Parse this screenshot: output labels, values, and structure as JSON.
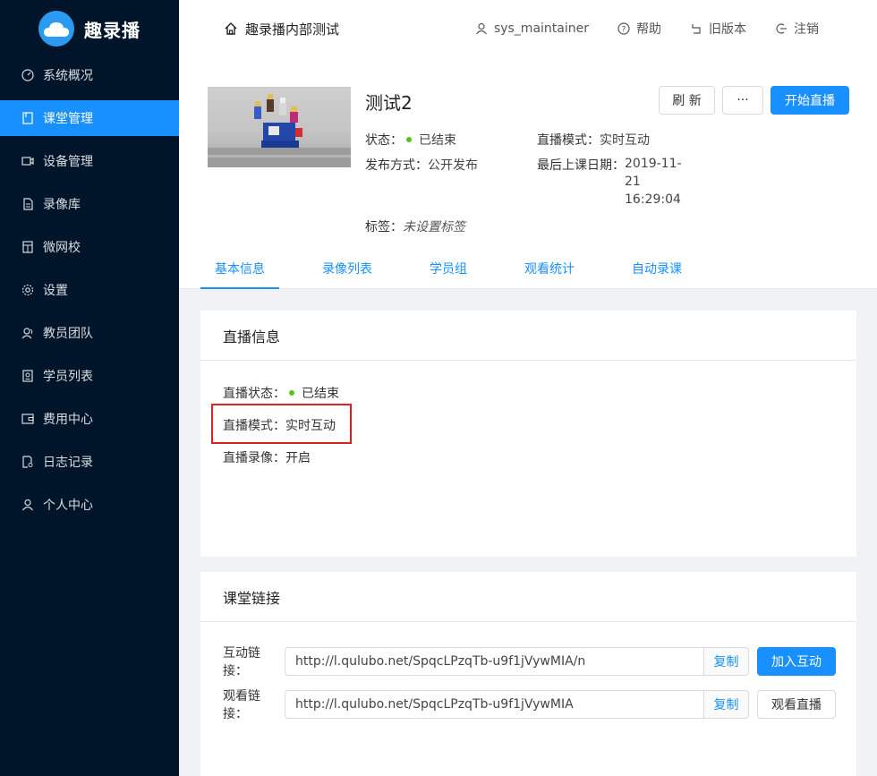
{
  "app": {
    "logo_text": "趣录播"
  },
  "sidebar": {
    "items": [
      {
        "label": "系统概况",
        "icon": "dashboard-icon"
      },
      {
        "label": "课堂管理",
        "icon": "book-icon"
      },
      {
        "label": "设备管理",
        "icon": "video-camera-icon"
      },
      {
        "label": "录像库",
        "icon": "file-icon"
      },
      {
        "label": "微网校",
        "icon": "calculator-icon"
      },
      {
        "label": "设置",
        "icon": "gear-icon"
      },
      {
        "label": "教员团队",
        "icon": "team-icon"
      },
      {
        "label": "学员列表",
        "icon": "profile-icon"
      },
      {
        "label": "费用中心",
        "icon": "wallet-icon"
      },
      {
        "label": "日志记录",
        "icon": "file-search-icon"
      },
      {
        "label": "个人中心",
        "icon": "user-icon"
      }
    ],
    "active_index": 1
  },
  "header": {
    "home_label": "趣录播内部测试",
    "user": "sys_maintainer",
    "help": "帮助",
    "old_version": "旧版本",
    "logout": "注销"
  },
  "course": {
    "title": "测试2",
    "status_label": "状态：",
    "status_value": "已结束",
    "mode_label": "直播模式：",
    "mode_value": "实时互动",
    "publish_label": "发布方式：",
    "publish_value": "公开发布",
    "last_date_label": "最后上课日期：",
    "last_date_line1": "2019-11-",
    "last_date_line2": "21",
    "last_date_line3": "16:29:04",
    "tags_label": "标签：",
    "tags_value": "未设置标签",
    "refresh_button": "刷 新",
    "more_button": "···",
    "start_button": "开始直播",
    "status_color": "#52c41a"
  },
  "tabs": [
    "基本信息",
    "录像列表",
    "学员组",
    "观看统计",
    "自动录课"
  ],
  "live_info": {
    "title": "直播信息",
    "status_label": "直播状态：",
    "status_value": "已结束",
    "mode_label": "直播模式：",
    "mode_value": "实时互动",
    "record_label": "直播录像：",
    "record_value": "开启"
  },
  "links": {
    "title": "课堂链接",
    "interact_label": "互动链接：",
    "interact_url": "http://l.qulubo.net/SpqcLPzqTb-u9f1jVywMIA/n",
    "watch_label": "观看链接：",
    "watch_url": "http://l.qulubo.net/SpqcLPzqTb-u9f1jVywMIA",
    "copy_label": "复制",
    "join_button": "加入互动",
    "watch_button": "观看直播"
  },
  "colors": {
    "primary": "#1890ff",
    "sidebar_bg": "#001529",
    "highlight": "#e02020"
  }
}
